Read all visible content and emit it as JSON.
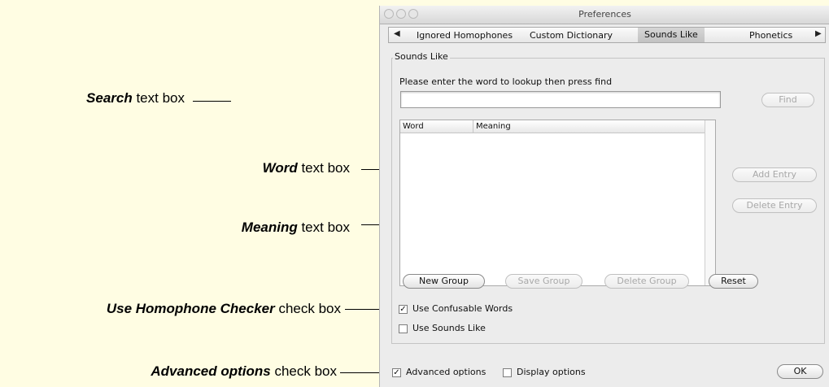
{
  "callouts": {
    "search": {
      "bold": "Search",
      "rest": " text box"
    },
    "word": {
      "bold": "Word",
      "rest": " text box"
    },
    "meaning": {
      "bold": "Meaning",
      "rest": " text box"
    },
    "homophone": {
      "bold": "Use Homophone Checker",
      "rest": " check box"
    },
    "advanced": {
      "bold": "Advanced options",
      "rest": " check box"
    }
  },
  "window": {
    "title": "Preferences",
    "tab_left_arrow": "◀",
    "tab_right_arrow": "▶",
    "tabs": [
      {
        "label": "Ignored Homophones",
        "active": false
      },
      {
        "label": "Custom Dictionary",
        "active": false
      },
      {
        "label": "Sounds Like",
        "active": true
      },
      {
        "label": "Phonetics",
        "active": false
      }
    ]
  },
  "sounds_like": {
    "group_title": "Sounds Like",
    "prompt": "Please enter the word to lookup then press find",
    "search_value": "",
    "find_label": "Find",
    "columns": [
      "Word",
      "Meaning"
    ],
    "rows": [],
    "add_entry_label": "Add Entry",
    "delete_entry_label": "Delete Entry",
    "new_group_label": "New Group",
    "save_group_label": "Save Group",
    "delete_group_label": "Delete Group",
    "reset_label": "Reset",
    "use_confusable_words": {
      "label": "Use Confusable Words",
      "checked": true
    },
    "use_sounds_like": {
      "label": "Use Sounds Like",
      "checked": false
    }
  },
  "footer": {
    "advanced_options": {
      "label": "Advanced options",
      "checked": true
    },
    "display_options": {
      "label": "Display options",
      "checked": false
    },
    "ok_label": "OK"
  },
  "colors": {
    "background": "#fffde3",
    "window": "#ececec"
  }
}
